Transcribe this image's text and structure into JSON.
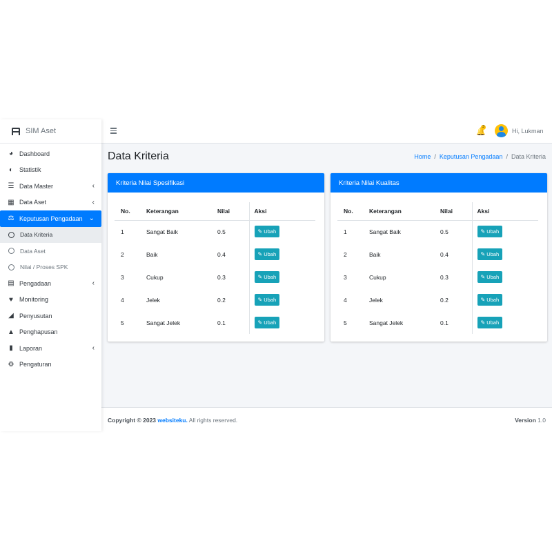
{
  "brand": {
    "title": "SIM Aset"
  },
  "sidebar": {
    "items": [
      {
        "label": "Dashboard",
        "icon": "gauge-icon"
      },
      {
        "label": "Statistik",
        "icon": "chart-pie-icon"
      },
      {
        "label": "Data Master",
        "icon": "database-icon",
        "has_children": true
      },
      {
        "label": "Data Aset",
        "icon": "building-icon",
        "has_children": true
      },
      {
        "label": "Keputusan Pengadaan",
        "icon": "balance-scale-icon",
        "has_children": true,
        "expanded": true
      },
      {
        "label": "Data Kriteria",
        "sub": true,
        "selected": true
      },
      {
        "label": "Data Aset",
        "sub": true
      },
      {
        "label": "Nilai / Proses SPK",
        "sub": true
      },
      {
        "label": "Pengadaan",
        "icon": "bar-chart-icon",
        "has_children": true
      },
      {
        "label": "Monitoring",
        "icon": "heart-pulse-icon"
      },
      {
        "label": "Penyusutan",
        "icon": "area-chart-icon"
      },
      {
        "label": "Penghapusan",
        "icon": "warning-icon"
      },
      {
        "label": "Laporan",
        "icon": "file-icon",
        "has_children": true
      },
      {
        "label": "Pengaturan",
        "icon": "gear-icon"
      }
    ]
  },
  "header": {
    "notification_count": "3",
    "user_greeting": "Hi, Lukman"
  },
  "page": {
    "title": "Data Kriteria",
    "breadcrumb": [
      "Home",
      "Keputusan Pengadaan",
      "Data Kriteria"
    ],
    "breadcrumb_sep": "/"
  },
  "cards": [
    {
      "title": "Kriteria Nilai Spesifikasi",
      "columns": [
        "No.",
        "Keterangan",
        "Nilai",
        "Aksi"
      ],
      "rows": [
        {
          "no": "1",
          "keterangan": "Sangat Baik",
          "nilai": "0.5",
          "aksi": "Ubah"
        },
        {
          "no": "2",
          "keterangan": "Baik",
          "nilai": "0.4",
          "aksi": "Ubah"
        },
        {
          "no": "3",
          "keterangan": "Cukup",
          "nilai": "0.3",
          "aksi": "Ubah"
        },
        {
          "no": "4",
          "keterangan": "Jelek",
          "nilai": "0.2",
          "aksi": "Ubah"
        },
        {
          "no": "5",
          "keterangan": "Sangat Jelek",
          "nilai": "0.1",
          "aksi": "Ubah"
        }
      ]
    },
    {
      "title": "Kriteria Nilai Kualitas",
      "columns": [
        "No.",
        "Keterangan",
        "Nilai",
        "Aksi"
      ],
      "rows": [
        {
          "no": "1",
          "keterangan": "Sangat Baik",
          "nilai": "0.5",
          "aksi": "Ubah"
        },
        {
          "no": "2",
          "keterangan": "Baik",
          "nilai": "0.4",
          "aksi": "Ubah"
        },
        {
          "no": "3",
          "keterangan": "Cukup",
          "nilai": "0.3",
          "aksi": "Ubah"
        },
        {
          "no": "4",
          "keterangan": "Jelek",
          "nilai": "0.2",
          "aksi": "Ubah"
        },
        {
          "no": "5",
          "keterangan": "Sangat Jelek",
          "nilai": "0.1",
          "aksi": "Ubah"
        }
      ]
    }
  ],
  "footer": {
    "copyright_prefix": "Copyright © 2023",
    "site": "websiteku.",
    "rights": "All rights reserved.",
    "version_label": "Version",
    "version": "1.0"
  },
  "colors": {
    "primary": "#007bff",
    "info": "#17a2b8",
    "warning": "#ffc107",
    "content_bg": "#f4f6f9"
  }
}
